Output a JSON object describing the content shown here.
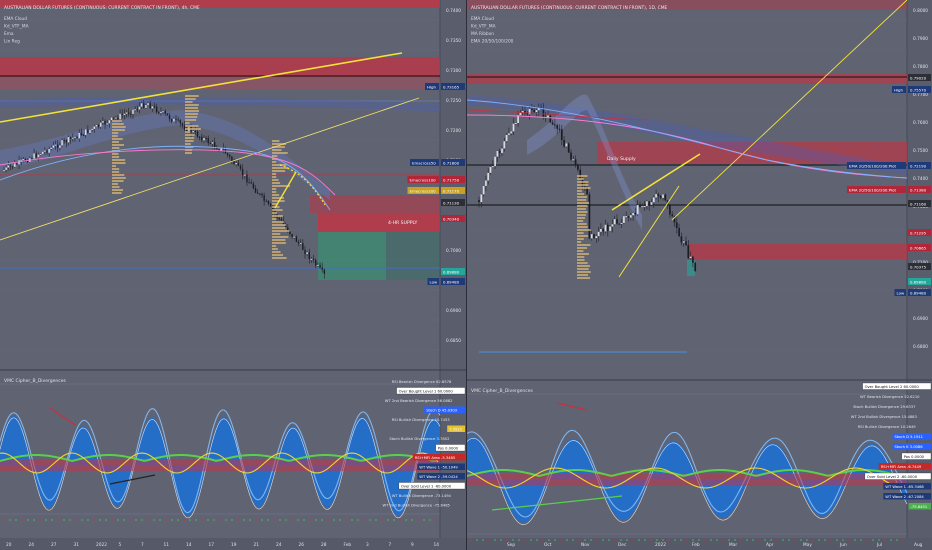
{
  "left": {
    "title": "AUSTRALIAN DOLLAR FUTURES (CONTINUOUS: CURRENT CONTRACT IN FRONT), 4h, CME",
    "indicators": [
      "EMA Cloud",
      "Kd_VTF_MA",
      "Ema",
      "Lin Reg"
    ],
    "annotation": "4-HR SUPPLY",
    "price_ticks": [
      "0.7400",
      "0.7350",
      "0.7300",
      "0.7250",
      "0.7200",
      "0.7150",
      "0.7100",
      "0.7050",
      "0.7000",
      "0.6950",
      "0.6900",
      "0.6850"
    ],
    "price_tags": [
      {
        "label": "High",
        "value": "0.73165",
        "color": "#1e3a78"
      },
      {
        "label": "Emacross50",
        "value": "0.71800",
        "color": "#1e3a78"
      },
      {
        "label": "Emacross100",
        "value": "0.71750",
        "color": "#b2263a"
      },
      {
        "label": "Emacross200",
        "value": "0.71170",
        "color": "#c9a020"
      },
      {
        "label": "",
        "value": "0.71130",
        "color": "#2d2f36"
      },
      {
        "label": "",
        "value": "0.70340",
        "color": "#b2263a"
      },
      {
        "label": "",
        "value": "0.69880",
        "color": "#26a69a"
      },
      {
        "label": "Low",
        "value": "0.69480",
        "color": "#1e3a78"
      }
    ],
    "date_ticks": [
      "20",
      "24",
      "27",
      "31",
      "2022",
      "5",
      "7",
      "11",
      "14",
      "17",
      "19",
      "21",
      "24",
      "26",
      "28",
      "Feb",
      "3",
      "7",
      "9",
      "14"
    ],
    "osc_title": "VMC Cipher_B_Divergences",
    "osc_labels": [
      {
        "label": "RSI Bearish Divergence",
        "value": "62.8578"
      },
      {
        "label": "Over Bought Level 1",
        "value": "60.0000",
        "box": true
      },
      {
        "label": "WT 2nd Bearish Divergence",
        "value": "56.0882"
      },
      {
        "label": "Stoch D",
        "value": "45.0303",
        "color": "#2962ff"
      },
      {
        "label": "RSI Bullish Divergence",
        "value": "40.7453"
      },
      {
        "label": "",
        "value": "7.9521",
        "color": "#e6c32a"
      },
      {
        "label": "Stoch Bullish Divergence",
        "value": "3.7802"
      },
      {
        "label": "Pos",
        "value": "0.0000",
        "box": true
      },
      {
        "label": "RSI+MFI Area",
        "value": "-5.3485",
        "color": "#c62828"
      },
      {
        "label": "WT Wave 1",
        "value": "-50.1049",
        "color": "#1e3a78"
      },
      {
        "label": "WT Wave 2",
        "value": "-59.0424",
        "color": "#1e3a78"
      },
      {
        "label": "Over Sold Level 1",
        "value": "-60.0000",
        "box": true
      },
      {
        "label": "WT Bullish Divergence",
        "value": "-73.1494"
      },
      {
        "label": "WT 2nd Bullish Divergence",
        "value": "-75.6485"
      }
    ]
  },
  "right": {
    "title": "AUSTRALIAN DOLLAR FUTURES (CONTINUOUS: CURRENT CONTRACT IN FRONT), 1D, CME",
    "indicators": [
      "EMA Cloud",
      "Kd_VTF_MA",
      "MA Ribbon",
      "EMA 20/50/100/200"
    ],
    "annotation": "Daily Supply",
    "price_ticks": [
      "0.8000",
      "0.7900",
      "0.7800",
      "0.7700",
      "0.7600",
      "0.7500",
      "0.7400",
      "0.7300",
      "0.7200",
      "0.7100",
      "0.7000",
      "0.6900",
      "0.6800"
    ],
    "price_tags": [
      {
        "label": "",
        "value": "0.79020",
        "color": "#2d2f36"
      },
      {
        "label": "High",
        "value": "0.75570",
        "color": "#1e3a78"
      },
      {
        "label": "EMA 20/50/100/200:Plot",
        "value": "0.72190",
        "color": "#1e3a78"
      },
      {
        "label": "EMA 20/50/100/200:Plot",
        "value": "0.71380",
        "color": "#b2263a"
      },
      {
        "label": "",
        "value": "0.71160",
        "color": "#2d2f36"
      },
      {
        "label": "",
        "value": "0.71295",
        "color": "#b2263a"
      },
      {
        "label": "",
        "value": "0.70665",
        "color": "#b2263a"
      },
      {
        "label": "",
        "value": "0.70375",
        "color": "#2d2f36"
      },
      {
        "label": "",
        "value": "0.69880",
        "color": "#26a69a"
      },
      {
        "label": "Low",
        "value": "0.69480",
        "color": "#1e3a78"
      }
    ],
    "date_ticks": [
      "Sep",
      "Oct",
      "Nov",
      "Dec",
      "2022",
      "Feb",
      "Mar",
      "Apr",
      "May",
      "Jun",
      "Jul",
      "Aug"
    ],
    "osc_title": "VMC Cipher_B_Divergences",
    "osc_labels": [
      {
        "label": "Over Bought Level 2",
        "value": "60.0000",
        "box": true
      },
      {
        "label": "WT Bearish Divergence",
        "value": "52.6210"
      },
      {
        "label": "Stoch Bullish Divergence",
        "value": "29.6337"
      },
      {
        "label": "WT 2nd Bullish Divergence",
        "value": "15.4883"
      },
      {
        "label": "RSI Bullish Divergence",
        "value": "10.2649"
      },
      {
        "label": "Stoch D",
        "value": "5.1911",
        "color": "#2962ff"
      },
      {
        "label": "Stoch K",
        "value": "3.0086",
        "color": "#2962ff"
      },
      {
        "label": "Pos",
        "value": "0.0000",
        "box": true
      },
      {
        "label": "RSI+MFI Area",
        "value": "-6.7449",
        "color": "#c62828"
      },
      {
        "label": "Over Sold Level 2",
        "value": "-60.0000",
        "box": true
      },
      {
        "label": "WT Wave 1",
        "value": "-65.3468",
        "color": "#1e3a78"
      },
      {
        "label": "WT Wave 2",
        "value": "-67.2084",
        "color": "#1e3a78"
      },
      {
        "label": "",
        "value": "-75.8451",
        "color": "#4caf50"
      }
    ]
  }
}
